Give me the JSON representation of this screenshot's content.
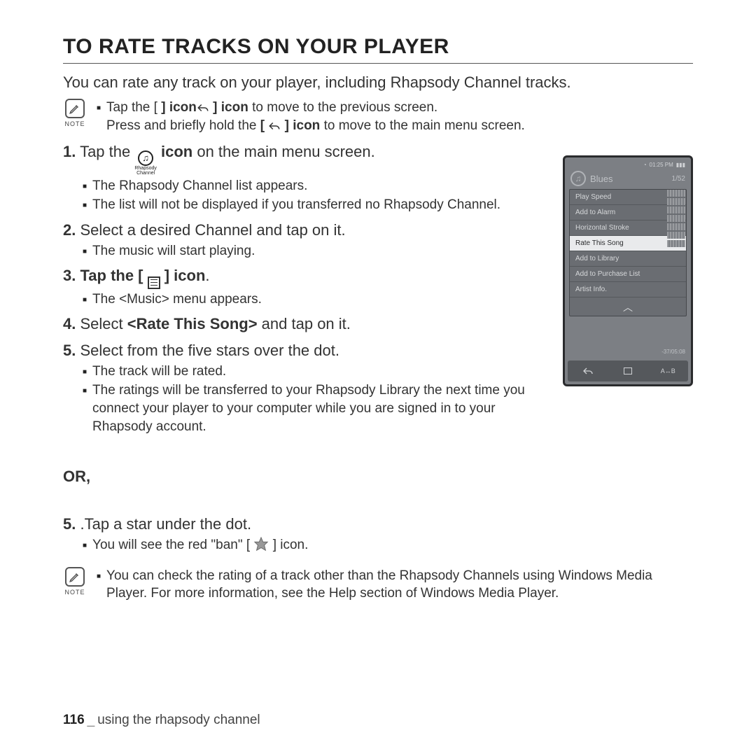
{
  "title": "TO RATE TRACKS ON YOUR PLAYER",
  "intro": "You can rate any track on your player, including Rhapsody Channel tracks.",
  "note1": {
    "label": "NOTE",
    "line1a": "Tap the [ ",
    "line1b": " ] icon",
    "line1c": " to move to the previous screen.",
    "line2a": "Press and briefly hold the ",
    "line2b": "[ ",
    "line2c": " ] icon",
    "line2d": " to move to the main menu screen."
  },
  "rhapsody_icon_label": "Rhapsody",
  "rhapsody_icon_label2": "Channel",
  "steps": {
    "s1_a": "1.",
    "s1_b": " Tap the ",
    "s1_c": " icon",
    "s1_d": " on the main menu screen.",
    "s1_sub1": "The Rhapsody Channel list appears.",
    "s1_sub2": "The list will not be displayed if you transferred no Rhapsody Channel.",
    "s2_a": "2.",
    "s2_b": " Select a desired Channel and tap on it.",
    "s2_sub1": "The music will start playing.",
    "s3_a": "3.",
    "s3_b": " Tap the [ ",
    "s3_c": " ] icon",
    "s3_d": ".",
    "s3_sub1": "The <Music> menu appears.",
    "s4_a": "4.",
    "s4_b": " Select ",
    "s4_c": "<Rate This Song>",
    "s4_d": " and tap on it.",
    "s5_a": "5.",
    "s5_b": " Select from the five stars over the dot.",
    "s5_sub1": "The track will be rated.",
    "s5_sub2": "The ratings will be transferred to your Rhapsody Library the next time you connect your player to your computer while you are signed in to your Rhapsody account."
  },
  "or": "OR,",
  "alt": {
    "s5_a": "5.",
    "s5_b": " .Tap a star under the dot.",
    "s5_sub_a": "You will see the red \"ban\" [ ",
    "s5_sub_b": " ] icon."
  },
  "note2": {
    "label": "NOTE",
    "text": "You can check the rating of a track other than the Rhapsody Channels using Windows Media Player. For more information, see the Help section of Windows Media Player."
  },
  "footer": {
    "page": "116",
    "section": "using the rhapsody channel"
  },
  "device": {
    "time": "01:25 PM",
    "title": "Blues",
    "count": "1/52",
    "menu": [
      "Play Speed",
      "Add to Alarm",
      "Horizontal Stroke",
      "Rate This Song",
      "Add to Library",
      "Add to Purchase List",
      "Artist Info."
    ],
    "selected_index": 3,
    "elapsed": "-37/05:08"
  }
}
